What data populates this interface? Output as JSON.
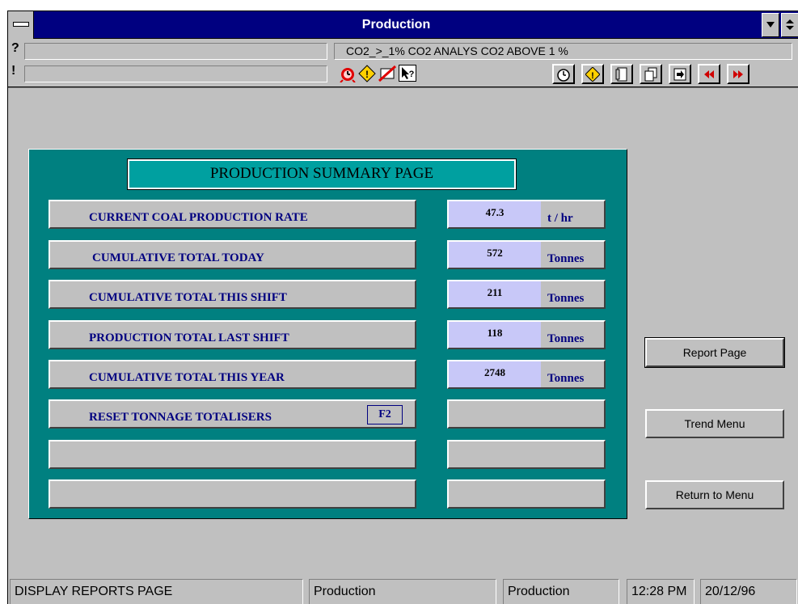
{
  "window": {
    "title": "Production"
  },
  "alarm_bar": {
    "row1_glyph": "?",
    "row2_glyph": "!",
    "message": "CO2_>_1%  CO2 ANALYS CO2 ABOVE 1 %"
  },
  "icons": {
    "small": [
      "alarm-clock-icon",
      "warning-diamond-icon",
      "no-entry-icon",
      "help-pointer-icon"
    ],
    "toolbar": [
      "clock-icon",
      "warning-icon",
      "document-icon",
      "pages-icon",
      "export-icon",
      "rewind-icon",
      "fast-forward-icon"
    ]
  },
  "colors": {
    "panel": "#008080",
    "title_bar": "#000080",
    "value_fill": "#c8c8f8",
    "label_text": "#000080"
  },
  "summary": {
    "title": "PRODUCTION SUMMARY PAGE",
    "rows": [
      {
        "label": "CURRENT COAL PRODUCTION RATE",
        "value": "47.3",
        "unit": "t / hr"
      },
      {
        "label": "CUMULATIVE TOTAL TODAY",
        "value": "572",
        "unit": "Tonnes"
      },
      {
        "label": "CUMULATIVE TOTAL THIS SHIFT",
        "value": "211",
        "unit": "Tonnes"
      },
      {
        "label": "PRODUCTION TOTAL LAST SHIFT",
        "value": "118",
        "unit": "Tonnes"
      },
      {
        "label": "CUMULATIVE TOTAL THIS YEAR",
        "value": "2748",
        "unit": "Tonnes"
      },
      {
        "label": "RESET TONNAGE TOTALISERS",
        "key": "F2"
      }
    ]
  },
  "buttons": {
    "report": "Report Page",
    "trend": "Trend Menu",
    "return": "Return to Menu"
  },
  "status_bar": {
    "message": "DISPLAY REPORTS PAGE",
    "area": "Production",
    "page": "Production",
    "time": "12:28 PM",
    "date": "20/12/96"
  }
}
